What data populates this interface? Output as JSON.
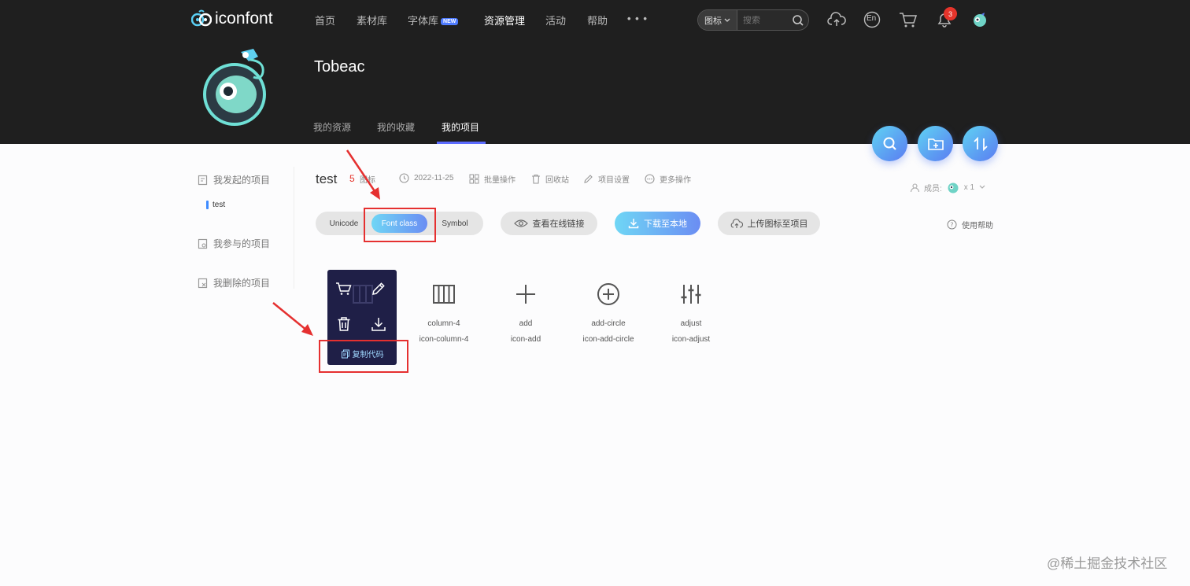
{
  "header": {
    "brand": "iconfont",
    "nav": [
      {
        "label": "首页"
      },
      {
        "label": "素材库"
      },
      {
        "label": "字体库",
        "badge": "NEW"
      },
      {
        "label": "资源管理",
        "active": true
      },
      {
        "label": "活动"
      },
      {
        "label": "帮助"
      },
      {
        "label": "• • •"
      }
    ],
    "search": {
      "type_label": "图标",
      "placeholder": "搜索"
    },
    "language": "En",
    "notifications_count": "3"
  },
  "profile": {
    "name": "Tobeac",
    "tabs": [
      {
        "label": "我的资源"
      },
      {
        "label": "我的收藏"
      },
      {
        "label": "我的项目",
        "active": true
      }
    ]
  },
  "sidebar": {
    "items": [
      {
        "label": "我发起的项目"
      },
      {
        "label": "我参与的项目"
      },
      {
        "label": "我删除的项目"
      }
    ],
    "active_project": "test"
  },
  "project": {
    "title": "test",
    "count": "5",
    "count_label": "图标",
    "date": "2022-11-25",
    "actions": [
      "批量操作",
      "回收站",
      "项目设置",
      "更多操作"
    ],
    "members_label": "成员:",
    "members_count": "x 1"
  },
  "toolbar": {
    "formats": [
      "Unicode",
      "Font class",
      "Symbol"
    ],
    "active_format": "Font class",
    "view_link": "查看在线链接",
    "download": "下载至本地",
    "upload": "上传图标至项目",
    "help": "使用帮助"
  },
  "hover_menu": {
    "copy_code": "复制代码"
  },
  "icons": [
    {
      "name": "column-4",
      "class": "icon-column-4"
    },
    {
      "name": "add",
      "class": "icon-add"
    },
    {
      "name": "add-circle",
      "class": "icon-add-circle"
    },
    {
      "name": "adjust",
      "class": "icon-adjust"
    }
  ],
  "watermark": "@稀土掘金技术社区",
  "colors": {
    "header_bg": "#1f1f1f",
    "accent_gradient_start": "#6fd6f5",
    "accent_gradient_end": "#6b8df3",
    "badge_red": "#e5342b",
    "annotation_red": "#e53030"
  }
}
